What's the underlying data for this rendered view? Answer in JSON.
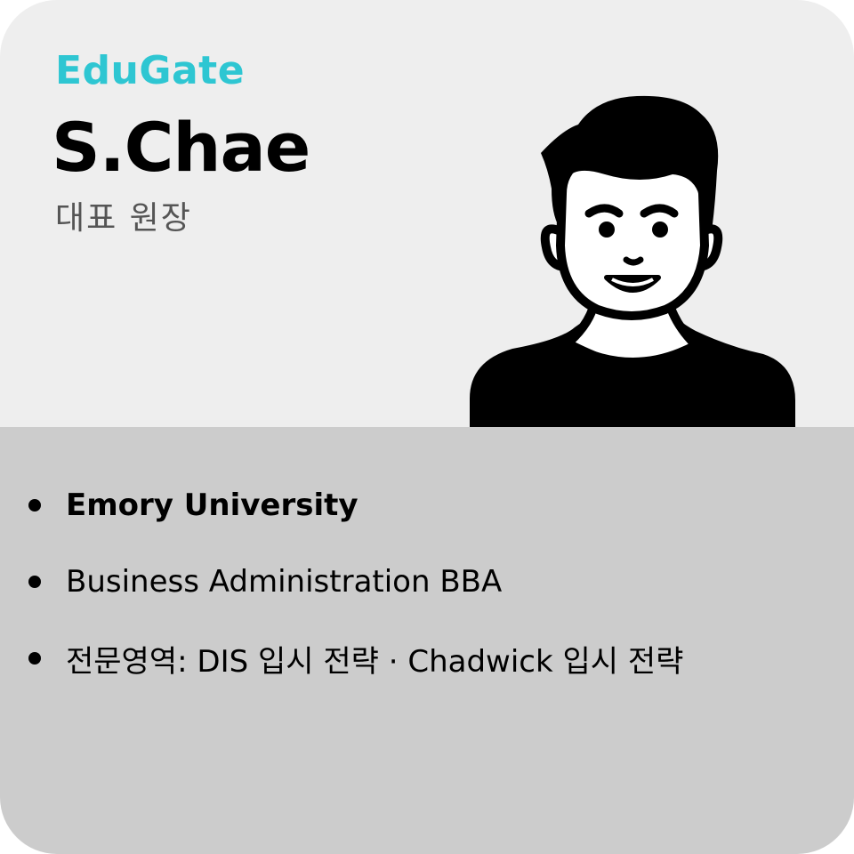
{
  "brand": {
    "name": "EduGate",
    "color": "#2ec6d2"
  },
  "profile": {
    "name": "S.Chae",
    "role": "대표 원장",
    "avatar_icon": "person-avatar-icon"
  },
  "details": {
    "items": [
      {
        "text": "Emory University",
        "bold": true
      },
      {
        "text": "Business Administration BBA",
        "bold": false
      },
      {
        "text": "전문영역: DIS 입시 전략 · Chadwick 입시 전략",
        "bold": false
      }
    ]
  },
  "colors": {
    "top_background": "#eeeeee",
    "bottom_background": "#cccccc",
    "text": "#000000"
  }
}
